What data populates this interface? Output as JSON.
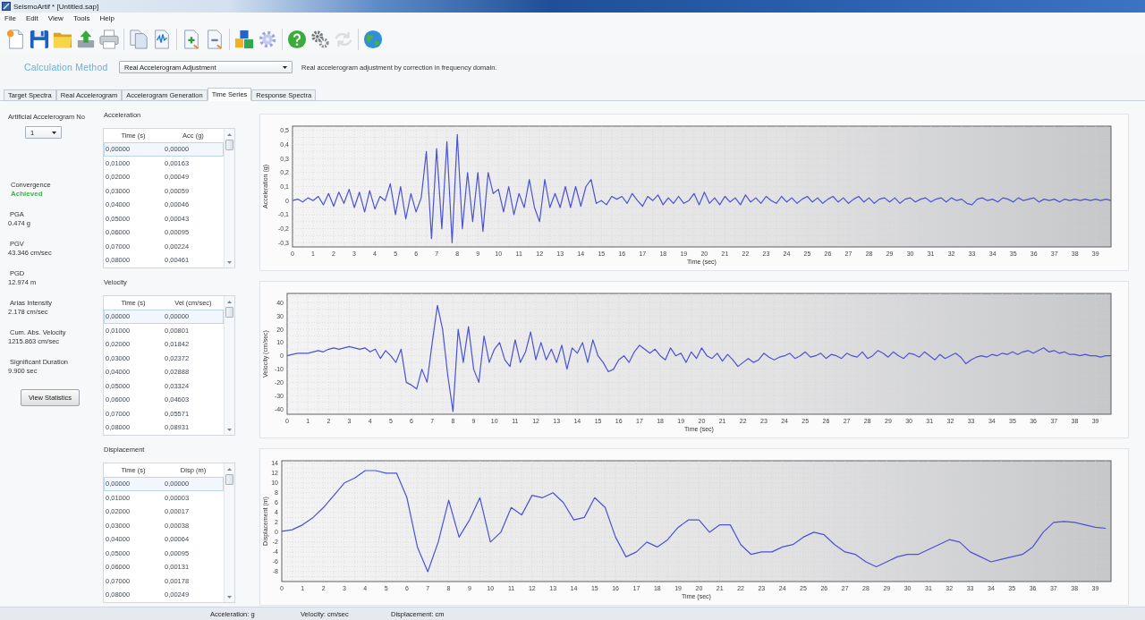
{
  "window": {
    "title": "SeismoArtif * [Untitled.sap]"
  },
  "menu": [
    "File",
    "Edit",
    "View",
    "Tools",
    "Help"
  ],
  "toolbar": {
    "groups": [
      {
        "buttons": [
          {
            "disabled": false
          },
          {
            "disabled": false
          },
          {
            "disabled": false
          },
          {
            "disabled": false
          },
          {
            "disabled": false
          }
        ]
      },
      {
        "buttons": [
          {
            "disabled": false
          },
          {
            "disabled": false
          }
        ]
      },
      {
        "buttons": [
          {
            "disabled": false
          },
          {
            "disabled": false
          }
        ]
      },
      {
        "buttons": [
          {
            "disabled": false
          },
          {
            "disabled": false
          }
        ]
      },
      {
        "buttons": [
          {
            "disabled": false
          },
          {
            "disabled": false
          },
          {
            "disabled": true
          }
        ]
      },
      {
        "buttons": [
          {
            "disabled": false
          }
        ]
      }
    ]
  },
  "calculation_method": {
    "label": "Calculation Method",
    "value": "Real Accelerogram Adjustment",
    "description": "Real accelerogram adjustment by correction in frequency domain."
  },
  "tabs": [
    {
      "label": "Target Spectra",
      "selected": false
    },
    {
      "label": "Real Accelerogram",
      "selected": false
    },
    {
      "label": "Accelerogram Generation",
      "selected": false
    },
    {
      "label": "Time Series",
      "selected": true
    },
    {
      "label": "Response Spectra",
      "selected": false
    }
  ],
  "summary": {
    "accelerogram": {
      "label": "Artificial Accelerogram No",
      "value": "1"
    },
    "convergence": {
      "label": "Convergence",
      "value": "Achieved"
    },
    "metrics": [
      {
        "label": "PGA",
        "value": "0.474 g"
      },
      {
        "label": "PGV",
        "value": "43.346 cm/sec"
      },
      {
        "label": "PGD",
        "value": "12.974 m"
      },
      {
        "label": "Arias Intensity",
        "value": "2.178 cm/sec"
      },
      {
        "label": "Cum. Abs. Velocity",
        "value": "1215.863 cm/sec"
      },
      {
        "label": "Significant Duration",
        "value": "9.900 sec"
      }
    ],
    "button": "View Statistics"
  },
  "series": [
    {
      "title": "Acceleration",
      "table": {
        "columns": [
          "Time (s)",
          "Acc (g)"
        ],
        "rows": [
          {
            "cells": [
              "0,00000",
              "0,00000"
            ],
            "selected": true
          },
          {
            "cells": [
              "0,01000",
              "0,00163"
            ],
            "selected": false
          },
          {
            "cells": [
              "0,02000",
              "0,00049"
            ],
            "selected": false
          },
          {
            "cells": [
              "0,03000",
              "0,00059"
            ],
            "selected": false
          },
          {
            "cells": [
              "0,04000",
              "0,00046"
            ],
            "selected": false
          },
          {
            "cells": [
              "0,05000",
              "0,00043"
            ],
            "selected": false
          },
          {
            "cells": [
              "0,06000",
              "0,00095"
            ],
            "selected": false
          },
          {
            "cells": [
              "0,07000",
              "0,00224"
            ],
            "selected": false
          },
          {
            "cells": [
              "0,08000",
              "0,00461"
            ],
            "selected": false
          }
        ]
      },
      "chart_data": {
        "type": "line",
        "xlabel": "Time (sec)",
        "ylabel": "Acceleration (g)",
        "grid": true,
        "x": [
          0,
          0.25,
          0.5,
          0.75,
          1,
          1.25,
          1.5,
          1.75,
          2,
          2.25,
          2.5,
          2.75,
          3,
          3.25,
          3.5,
          3.75,
          4,
          4.25,
          4.5,
          4.75,
          5,
          5.25,
          5.5,
          5.75,
          6,
          6.25,
          6.5,
          6.75,
          7,
          7.25,
          7.5,
          7.75,
          8,
          8.25,
          8.5,
          8.75,
          9,
          9.25,
          9.5,
          9.75,
          10,
          10.25,
          10.5,
          10.75,
          11,
          11.25,
          11.5,
          11.75,
          12,
          12.25,
          12.5,
          12.75,
          13,
          13.25,
          13.5,
          13.75,
          14,
          14.25,
          14.5,
          14.75,
          15,
          15.25,
          15.5,
          15.75,
          16,
          16.25,
          16.5,
          16.75,
          17,
          17.25,
          17.5,
          17.75,
          18,
          18.25,
          18.5,
          18.75,
          19,
          19.25,
          19.5,
          19.75,
          20,
          20.25,
          20.5,
          20.75,
          21,
          21.25,
          21.5,
          21.75,
          22,
          22.25,
          22.5,
          22.75,
          23,
          23.25,
          23.5,
          23.75,
          24,
          24.25,
          24.5,
          24.75,
          25,
          25.25,
          25.5,
          25.75,
          26,
          26.25,
          26.5,
          26.75,
          27,
          27.25,
          27.5,
          27.75,
          28,
          28.25,
          28.5,
          28.75,
          29,
          29.25,
          29.5,
          29.75,
          30,
          30.25,
          30.5,
          30.75,
          31,
          31.25,
          31.5,
          31.75,
          32,
          32.25,
          32.5,
          32.75,
          33,
          33.25,
          33.5,
          33.75,
          34,
          34.25,
          34.5,
          34.75,
          35,
          35.25,
          35.5,
          35.75,
          36,
          36.25,
          36.5,
          36.75,
          37,
          37.25,
          37.5,
          37.75,
          38,
          38.25,
          38.5,
          38.75,
          39,
          39.25,
          39.5,
          39.75
        ],
        "series": [
          {
            "color": "#4c52d4",
            "values": [
              0,
              0.01,
              -0.01,
              0.02,
              0,
              0.03,
              -0.03,
              0.05,
              -0.04,
              0.06,
              -0.02,
              0.08,
              -0.05,
              0.06,
              -0.08,
              0.07,
              -0.06,
              0.03,
              0,
              0.12,
              -0.1,
              0.1,
              -0.13,
              0.05,
              -0.08,
              0.02,
              0.35,
              -0.27,
              0.37,
              -0.2,
              0.42,
              -0.3,
              0.47,
              -0.2,
              0.2,
              -0.15,
              0.2,
              -0.22,
              0.2,
              0.05,
              0.08,
              -0.08,
              0.1,
              -0.1,
              0.05,
              -0.05,
              0.15,
              -0.05,
              -0.15,
              0.15,
              -0.05,
              0.05,
              -0.05,
              0.1,
              -0.05,
              0.1,
              -0.04,
              0.1,
              0.15,
              -0.02,
              0,
              -0.03,
              0.03,
              0.01,
              0.03,
              -0.02,
              0.05,
              0,
              -0.04,
              0.03,
              0,
              0.04,
              -0.03,
              0.02,
              -0.02,
              0.03,
              -0.02,
              0,
              0.05,
              -0.03,
              0.06,
              -0.02,
              0.02,
              -0.03,
              0.03,
              -0.01,
              0.02,
              -0.03,
              0.04,
              -0.01,
              0.02,
              -0.02,
              0.03,
              0,
              -0.02,
              0.03,
              -0.01,
              0.02,
              -0.02,
              0.01,
              0.03,
              -0.01,
              0.02,
              -0.02,
              0.01,
              0.03,
              -0.01,
              0.02,
              -0.02,
              0.01,
              0.03,
              -0.01,
              0.02,
              -0.02,
              0.01,
              0.02,
              -0.01,
              0.02,
              -0.02,
              0.01,
              0.02,
              -0.01,
              0.01,
              0.02,
              -0.01,
              0.01,
              0.02,
              -0.01,
              0.02,
              0,
              0.01,
              -0.02,
              -0.03,
              0.01,
              0.02,
              0,
              0.01,
              -0.01,
              0.02,
              0.01,
              -0.01,
              0.02,
              0,
              0.01,
              0.02,
              -0.01,
              0.01,
              0,
              0.01,
              -0.01,
              0.01,
              0,
              0.01,
              0,
              0.01,
              0,
              0.01,
              0,
              0.01,
              0
            ]
          }
        ],
        "xlim": [
          0,
          39.75
        ],
        "ylim": [
          -0.33,
          0.53
        ],
        "xticks": [
          0,
          1,
          2,
          3,
          4,
          5,
          6,
          7,
          8,
          9,
          10,
          11,
          12,
          13,
          14,
          15,
          16,
          17,
          18,
          19,
          20,
          21,
          22,
          23,
          24,
          25,
          26,
          27,
          28,
          29,
          30,
          31,
          32,
          33,
          34,
          35,
          36,
          37,
          38,
          39
        ],
        "yticks": [
          {
            "value": 0.5,
            "label": "0,5"
          },
          {
            "value": 0.4,
            "label": "0,4"
          },
          {
            "value": 0.3,
            "label": "0,3"
          },
          {
            "value": 0.2,
            "label": "0,2"
          },
          {
            "value": 0.1,
            "label": "0,1"
          },
          0,
          {
            "value": -0.1,
            "label": "-0,1"
          },
          {
            "value": -0.2,
            "label": "-0,2"
          },
          {
            "value": -0.3,
            "label": "-0,3"
          }
        ]
      }
    },
    {
      "title": "Velocity",
      "table": {
        "columns": [
          "Time (s)",
          "Vel (cm/sec)"
        ],
        "rows": [
          {
            "cells": [
              "0,00000",
              "0,00000"
            ],
            "selected": true
          },
          {
            "cells": [
              "0,01000",
              "0,00801"
            ],
            "selected": false
          },
          {
            "cells": [
              "0,02000",
              "0,01842"
            ],
            "selected": false
          },
          {
            "cells": [
              "0,03000",
              "0,02372"
            ],
            "selected": false
          },
          {
            "cells": [
              "0,04000",
              "0,02888"
            ],
            "selected": false
          },
          {
            "cells": [
              "0,05000",
              "0,03324"
            ],
            "selected": false
          },
          {
            "cells": [
              "0,06000",
              "0,04603"
            ],
            "selected": false
          },
          {
            "cells": [
              "0,07000",
              "0,05571"
            ],
            "selected": false
          },
          {
            "cells": [
              "0,08000",
              "0,08931"
            ],
            "selected": false
          }
        ]
      },
      "chart_data": {
        "type": "line",
        "xlabel": "Time (sec)",
        "ylabel": "Velocity (cm/sec)",
        "grid": true,
        "x": [
          0,
          0.25,
          0.5,
          0.75,
          1,
          1.25,
          1.5,
          1.75,
          2,
          2.25,
          2.5,
          2.75,
          3,
          3.25,
          3.5,
          3.75,
          4,
          4.25,
          4.5,
          4.75,
          5,
          5.25,
          5.5,
          5.75,
          6,
          6.25,
          6.5,
          6.75,
          7,
          7.25,
          7.5,
          7.75,
          8,
          8.25,
          8.5,
          8.75,
          9,
          9.25,
          9.5,
          9.75,
          10,
          10.25,
          10.5,
          10.75,
          11,
          11.25,
          11.5,
          11.75,
          12,
          12.25,
          12.5,
          12.75,
          13,
          13.25,
          13.5,
          13.75,
          14,
          14.25,
          14.5,
          14.75,
          15,
          15.25,
          15.5,
          15.75,
          16,
          16.25,
          16.5,
          16.75,
          17,
          17.25,
          17.5,
          17.75,
          18,
          18.25,
          18.5,
          18.75,
          19,
          19.25,
          19.5,
          19.75,
          20,
          20.25,
          20.5,
          20.75,
          21,
          21.25,
          21.5,
          21.75,
          22,
          22.25,
          22.5,
          22.75,
          23,
          23.25,
          23.5,
          23.75,
          24,
          24.25,
          24.5,
          24.75,
          25,
          25.25,
          25.5,
          25.75,
          26,
          26.25,
          26.5,
          26.75,
          27,
          27.25,
          27.5,
          27.75,
          28,
          28.25,
          28.5,
          28.75,
          29,
          29.25,
          29.5,
          29.75,
          30,
          30.25,
          30.5,
          30.75,
          31,
          31.25,
          31.5,
          31.75,
          32,
          32.25,
          32.5,
          32.75,
          33,
          33.25,
          33.5,
          33.75,
          34,
          34.25,
          34.5,
          34.75,
          35,
          35.25,
          35.5,
          35.75,
          36,
          36.25,
          36.5,
          36.75,
          37,
          37.25,
          37.5,
          37.75,
          38,
          38.25,
          38.5,
          38.75,
          39,
          39.25,
          39.5,
          39.75
        ],
        "series": [
          {
            "color": "#4c52d4",
            "values": [
              0,
              1,
              2,
              2,
              2,
              3,
              4,
              3,
              5,
              6,
              5,
              6,
              7,
              6,
              5,
              6,
              3,
              5,
              -2,
              4,
              0,
              -5,
              5,
              -20,
              -22,
              -25,
              -10,
              -20,
              10,
              38,
              20,
              -15,
              -42,
              20,
              -5,
              22,
              -10,
              -20,
              15,
              -5,
              5,
              10,
              -3,
              -8,
              12,
              -5,
              3,
              18,
              -3,
              10,
              -3,
              5,
              -5,
              8,
              -10,
              6,
              2,
              10,
              -5,
              12,
              0,
              -5,
              -12,
              -10,
              -3,
              0,
              -5,
              3,
              8,
              5,
              2,
              5,
              0,
              -3,
              6,
              0,
              2,
              -5,
              3,
              -2,
              6,
              0,
              -2,
              2,
              -4,
              1,
              -3,
              -8,
              -5,
              -2,
              -5,
              -3,
              2,
              -1,
              -3,
              -1,
              0,
              2,
              -2,
              0,
              3,
              -1,
              0,
              2,
              -2,
              1,
              0,
              -2,
              2,
              0,
              -1,
              3,
              -2,
              0,
              4,
              2,
              -1,
              3,
              0,
              -2,
              2,
              1,
              -1,
              3,
              0,
              -3,
              1,
              -2,
              0,
              2,
              -1,
              -6,
              -3,
              -1,
              0,
              -1,
              1,
              0,
              2,
              1,
              3,
              1,
              3,
              4,
              2,
              4,
              6,
              3,
              4,
              2,
              3,
              1,
              1,
              0,
              1,
              0,
              0,
              -1,
              0,
              0
            ]
          }
        ],
        "xlim": [
          0,
          39.75
        ],
        "ylim": [
          -44,
          47
        ],
        "xticks": [
          0,
          1,
          2,
          3,
          4,
          5,
          6,
          7,
          8,
          9,
          10,
          11,
          12,
          13,
          14,
          15,
          16,
          17,
          18,
          19,
          20,
          21,
          22,
          23,
          24,
          25,
          26,
          27,
          28,
          29,
          30,
          31,
          32,
          33,
          34,
          35,
          36,
          37,
          38,
          39
        ],
        "yticks": [
          40,
          30,
          20,
          10,
          0,
          -10,
          -20,
          -30,
          -40
        ]
      }
    },
    {
      "title": "Displacement",
      "table": {
        "columns": [
          "Time (s)",
          "Disp (m)"
        ],
        "rows": [
          {
            "cells": [
              "0,00000",
              "0,00000"
            ],
            "selected": true
          },
          {
            "cells": [
              "0,01000",
              "0,00003"
            ],
            "selected": false
          },
          {
            "cells": [
              "0,02000",
              "0,00017"
            ],
            "selected": false
          },
          {
            "cells": [
              "0,03000",
              "0,00038"
            ],
            "selected": false
          },
          {
            "cells": [
              "0,04000",
              "0,00064"
            ],
            "selected": false
          },
          {
            "cells": [
              "0,05000",
              "0,00095"
            ],
            "selected": false
          },
          {
            "cells": [
              "0,06000",
              "0,00131"
            ],
            "selected": false
          },
          {
            "cells": [
              "0,07000",
              "0,00178"
            ],
            "selected": false
          },
          {
            "cells": [
              "0,08000",
              "0,00249"
            ],
            "selected": false
          }
        ]
      },
      "chart_data": {
        "type": "line",
        "xlabel": "Time (sec)",
        "ylabel": "Displacement (m)",
        "grid": true,
        "x": [
          0,
          0.5,
          1,
          1.5,
          2,
          2.5,
          3,
          3.5,
          4,
          4.5,
          5,
          5.5,
          6,
          6.5,
          7,
          7.5,
          8,
          8.5,
          9,
          9.5,
          10,
          10.5,
          11,
          11.5,
          12,
          12.5,
          13,
          13.5,
          14,
          14.5,
          15,
          15.5,
          16,
          16.5,
          17,
          17.5,
          18,
          18.5,
          19,
          19.5,
          20,
          20.5,
          21,
          21.5,
          22,
          22.5,
          23,
          23.5,
          24,
          24.5,
          25,
          25.5,
          26,
          26.5,
          27,
          27.5,
          28,
          28.5,
          29,
          29.5,
          30,
          30.5,
          31,
          31.5,
          32,
          32.5,
          33,
          33.5,
          34,
          34.5,
          35,
          35.5,
          36,
          36.5,
          37,
          37.5,
          38,
          38.5,
          39,
          39.5
        ],
        "series": [
          {
            "color": "#4c52d4",
            "values": [
              0.2,
              0.5,
              1.5,
              3,
              5,
              7.5,
              10,
              11,
              12.5,
              12.5,
              12,
              12,
              7,
              -3,
              -8,
              -2,
              6.5,
              -1,
              2.5,
              7,
              -2,
              0,
              5,
              3.5,
              7.5,
              7,
              8,
              6,
              2.5,
              3,
              7,
              5,
              -1,
              -5,
              -4,
              -2,
              -3,
              -1.5,
              1,
              2.5,
              2.5,
              0,
              1.5,
              1.5,
              -2.5,
              -4.5,
              -4,
              -4,
              -3,
              -2.5,
              -1,
              0,
              -0.5,
              -2.5,
              -4,
              -4.5,
              -6,
              -7,
              -6,
              -5,
              -4.5,
              -4.5,
              -3.5,
              -2.5,
              -1.5,
              -2,
              -4,
              -5,
              -6,
              -5.5,
              -5,
              -4.5,
              -3,
              0,
              2,
              2.2,
              2,
              1.5,
              1,
              0.8
            ]
          }
        ],
        "xlim": [
          0,
          39.75
        ],
        "ylim": [
          -10,
          14.5
        ],
        "xticks": [
          0,
          1,
          2,
          3,
          4,
          5,
          6,
          7,
          8,
          9,
          10,
          11,
          12,
          13,
          14,
          15,
          16,
          17,
          18,
          19,
          20,
          21,
          22,
          23,
          24,
          25,
          26,
          27,
          28,
          29,
          30,
          31,
          32,
          33,
          34,
          35,
          36,
          37,
          38,
          39
        ],
        "yticks": [
          14,
          12,
          10,
          8,
          6,
          4,
          2,
          0,
          -2,
          -4,
          -6,
          -8
        ]
      }
    }
  ],
  "status_bar": [
    "Acceleration: g",
    "Velocity: cm/sec",
    "Displacement: cm"
  ]
}
